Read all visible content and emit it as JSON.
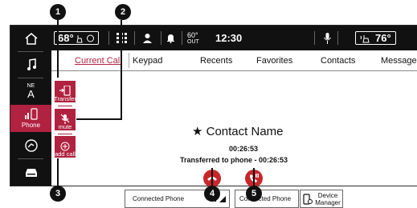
{
  "callouts": [
    "1",
    "2",
    "3",
    "4",
    "5"
  ],
  "sidebar": {
    "items": [
      {
        "icon": "home-icon",
        "label": ""
      },
      {
        "icon": "music-note-icon",
        "label": ""
      },
      {
        "icon": "compass-icon",
        "label": "NE",
        "sub": "A"
      },
      {
        "icon": "phone-icon",
        "label": "Phone",
        "active": true
      },
      {
        "icon": "controls-icon",
        "label": ""
      },
      {
        "icon": "car-icon",
        "label": ""
      }
    ]
  },
  "status_bar": {
    "driver_temp": "68°",
    "outside_label": "OUT",
    "outside_temp": "60°",
    "time": "12:30",
    "passenger_temp": "76°"
  },
  "tabs": [
    "Current Call",
    "Keypad",
    "Recents",
    "Favorites",
    "Contacts",
    "Messages"
  ],
  "active_tab": "Current Call",
  "controls": {
    "transfer": "Transfer",
    "mute": "mute",
    "add_call": "add call"
  },
  "call": {
    "star": "★",
    "contact_name": "Contact Name",
    "duration": "00:26:53",
    "transfer_status": "Transferred to phone - 00:26:53"
  },
  "bottom": {
    "connected_phone_1": "Connected Phone",
    "connected_phone_2": "Connected Phone",
    "device_manager": "Device Manager"
  },
  "colors": {
    "accent": "#b0223f",
    "end_call": "#c8262c",
    "bar": "#111111"
  }
}
